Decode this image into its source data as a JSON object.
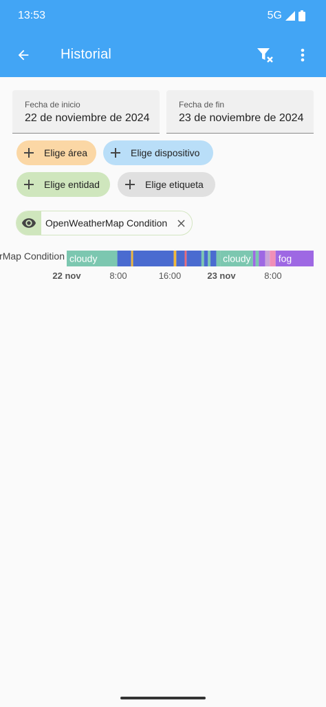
{
  "status_bar": {
    "time": "13:53",
    "network": "5G"
  },
  "toolbar": {
    "title": "Historial"
  },
  "dates": {
    "start_label": "Fecha de inicio",
    "start_value": "22 de noviembre de 2024",
    "end_label": "Fecha de fin",
    "end_value": "23 de noviembre de 2024"
  },
  "targets": {
    "area": "Elige área",
    "device": "Elige dispositivo",
    "entity": "Elige entidad",
    "label": "Elige etiqueta"
  },
  "selected_entity": {
    "name": "OpenWeatherMap Condition"
  },
  "colors": {
    "header": "#42a5f5",
    "area_chip": "#fbd7a5",
    "device_chip": "#b9def8",
    "entity_chip": "#cfe6bd",
    "label_chip": "#e0e0e0"
  },
  "chart_data": {
    "type": "timeline",
    "row_label": "OpenWeatherMap Condition",
    "range_hours": [
      0,
      32
    ],
    "ticks": [
      {
        "label": "22 nov",
        "hour": 0,
        "bold": true
      },
      {
        "label": "8:00",
        "hour": 8,
        "bold": false
      },
      {
        "label": "16:00",
        "hour": 16,
        "bold": false
      },
      {
        "label": "23 nov",
        "hour": 24,
        "bold": true
      },
      {
        "label": "8:00",
        "hour": 32,
        "bold": false
      }
    ],
    "segments": [
      {
        "start": 0.0,
        "end": 7.85,
        "state": "cloudy",
        "color": "#7cc7b0",
        "label": "cloudy"
      },
      {
        "start": 7.85,
        "end": 10.0,
        "state": "",
        "color": "#4a6bd0",
        "label": ""
      },
      {
        "start": 10.0,
        "end": 10.3,
        "state": "",
        "color": "#f0b83a",
        "label": ""
      },
      {
        "start": 10.3,
        "end": 16.6,
        "state": "",
        "color": "#4a6bd0",
        "label": ""
      },
      {
        "start": 16.6,
        "end": 17.0,
        "state": "",
        "color": "#f0b83a",
        "label": ""
      },
      {
        "start": 17.0,
        "end": 18.3,
        "state": "",
        "color": "#4a6bd0",
        "label": ""
      },
      {
        "start": 18.3,
        "end": 18.6,
        "state": "",
        "color": "#ea6a7a",
        "label": ""
      },
      {
        "start": 18.6,
        "end": 20.9,
        "state": "",
        "color": "#4a6bd0",
        "label": ""
      },
      {
        "start": 20.9,
        "end": 21.3,
        "state": "",
        "color": "#7cc7b0",
        "label": ""
      },
      {
        "start": 21.3,
        "end": 21.9,
        "state": "",
        "color": "#4a6bd0",
        "label": ""
      },
      {
        "start": 21.9,
        "end": 22.3,
        "state": "",
        "color": "#7cc7b0",
        "label": ""
      },
      {
        "start": 22.3,
        "end": 23.2,
        "state": "",
        "color": "#4a6bd0",
        "label": ""
      },
      {
        "start": 23.2,
        "end": 23.8,
        "state": "",
        "color": "#7cc7b0",
        "label": ""
      },
      {
        "start": 23.8,
        "end": 28.9,
        "state": "cloudy",
        "color": "#7cc7b0",
        "label": "cloudy"
      },
      {
        "start": 28.9,
        "end": 29.3,
        "state": "",
        "color": "#9e68e3",
        "label": ""
      },
      {
        "start": 29.3,
        "end": 29.8,
        "state": "",
        "color": "#7cc7b0",
        "label": ""
      },
      {
        "start": 29.8,
        "end": 30.8,
        "state": "",
        "color": "#9e68e3",
        "label": ""
      },
      {
        "start": 30.8,
        "end": 31.5,
        "state": "",
        "color": "#c9a3d9",
        "label": ""
      },
      {
        "start": 31.5,
        "end": 32.4,
        "state": "",
        "color": "#f08fb7",
        "label": ""
      },
      {
        "start": 32.4,
        "end": 38.3,
        "state": "fog",
        "color": "#9e68e3",
        "label": "fog"
      }
    ],
    "total_hours": 38.3
  }
}
